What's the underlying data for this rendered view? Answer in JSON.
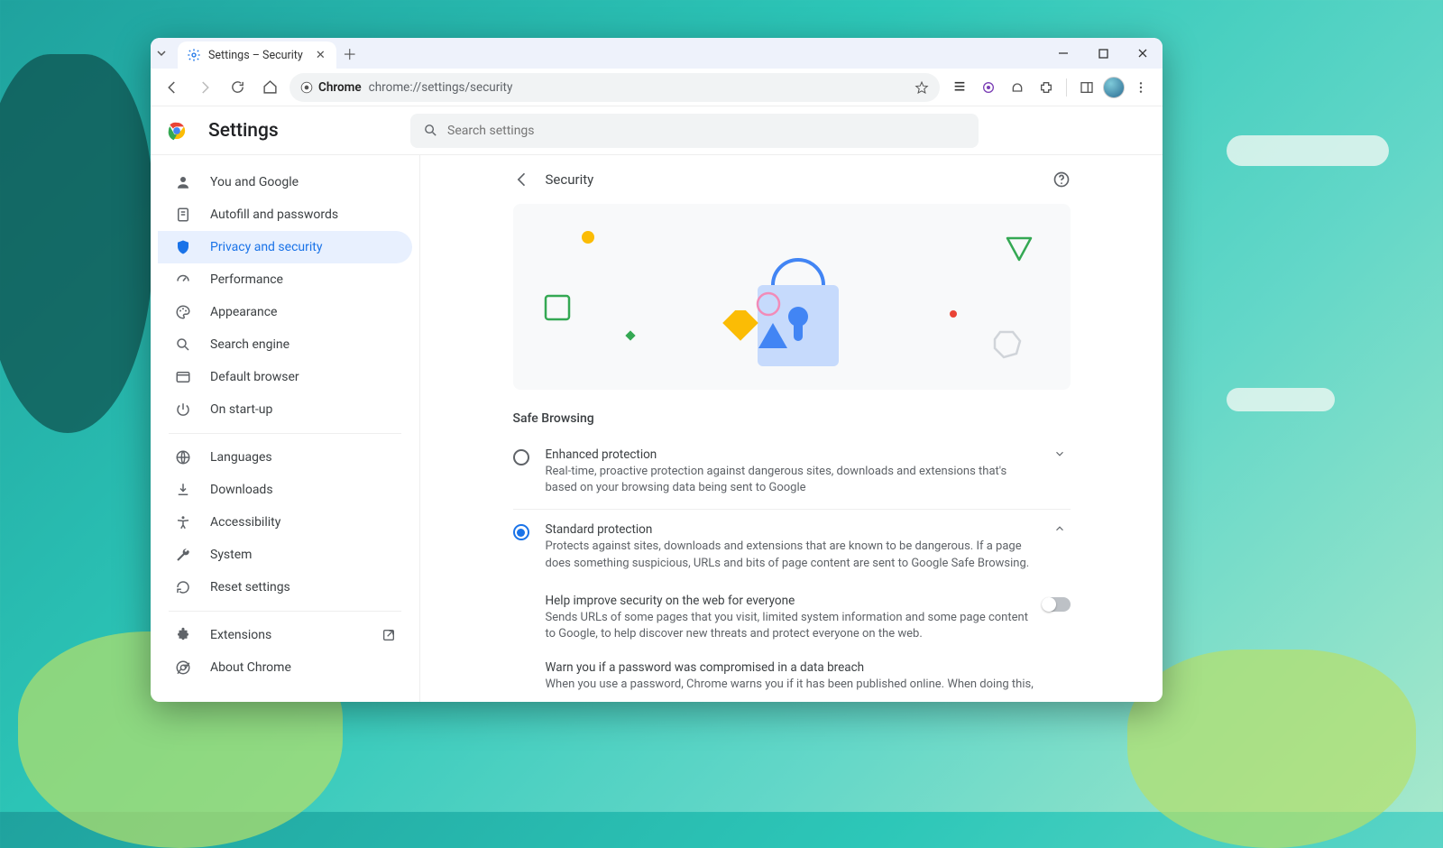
{
  "tab": {
    "title": "Settings – Security"
  },
  "omnibox": {
    "chip": "Chrome",
    "url": "chrome://settings/security"
  },
  "header": {
    "title": "Settings",
    "search_placeholder": "Search settings"
  },
  "sidebar": {
    "groups": [
      [
        {
          "icon": "person",
          "label": "You and Google"
        },
        {
          "icon": "autofill",
          "label": "Autofill and passwords"
        },
        {
          "icon": "shield",
          "label": "Privacy and security",
          "active": true
        },
        {
          "icon": "speed",
          "label": "Performance"
        },
        {
          "icon": "palette",
          "label": "Appearance"
        },
        {
          "icon": "search",
          "label": "Search engine"
        },
        {
          "icon": "browser",
          "label": "Default browser"
        },
        {
          "icon": "power",
          "label": "On start-up"
        }
      ],
      [
        {
          "icon": "globe",
          "label": "Languages"
        },
        {
          "icon": "download",
          "label": "Downloads"
        },
        {
          "icon": "accessibility",
          "label": "Accessibility"
        },
        {
          "icon": "wrench",
          "label": "System"
        },
        {
          "icon": "reset",
          "label": "Reset settings"
        }
      ],
      [
        {
          "icon": "extension",
          "label": "Extensions",
          "external": true
        },
        {
          "icon": "chrome",
          "label": "About Chrome"
        }
      ]
    ]
  },
  "page": {
    "title": "Security",
    "section": "Safe Browsing",
    "options": [
      {
        "title": "Enhanced protection",
        "desc": "Real-time, proactive protection against dangerous sites, downloads and extensions that's based on your browsing data being sent to Google",
        "checked": false,
        "expand": "down"
      },
      {
        "title": "Standard protection",
        "desc": "Protects against sites, downloads and extensions that are known to be dangerous. If a page does something suspicious, URLs and bits of page content are sent to Google Safe Browsing.",
        "checked": true,
        "expand": "up"
      }
    ],
    "sub": [
      {
        "title": "Help improve security on the web for everyone",
        "desc": "Sends URLs of some pages that you visit, limited system information and some page content to Google, to help discover new threats and protect everyone on the web."
      },
      {
        "title": "Warn you if a password was compromised in a data breach",
        "desc": "When you use a password, Chrome warns you if it has been published online. When doing this,"
      }
    ]
  }
}
